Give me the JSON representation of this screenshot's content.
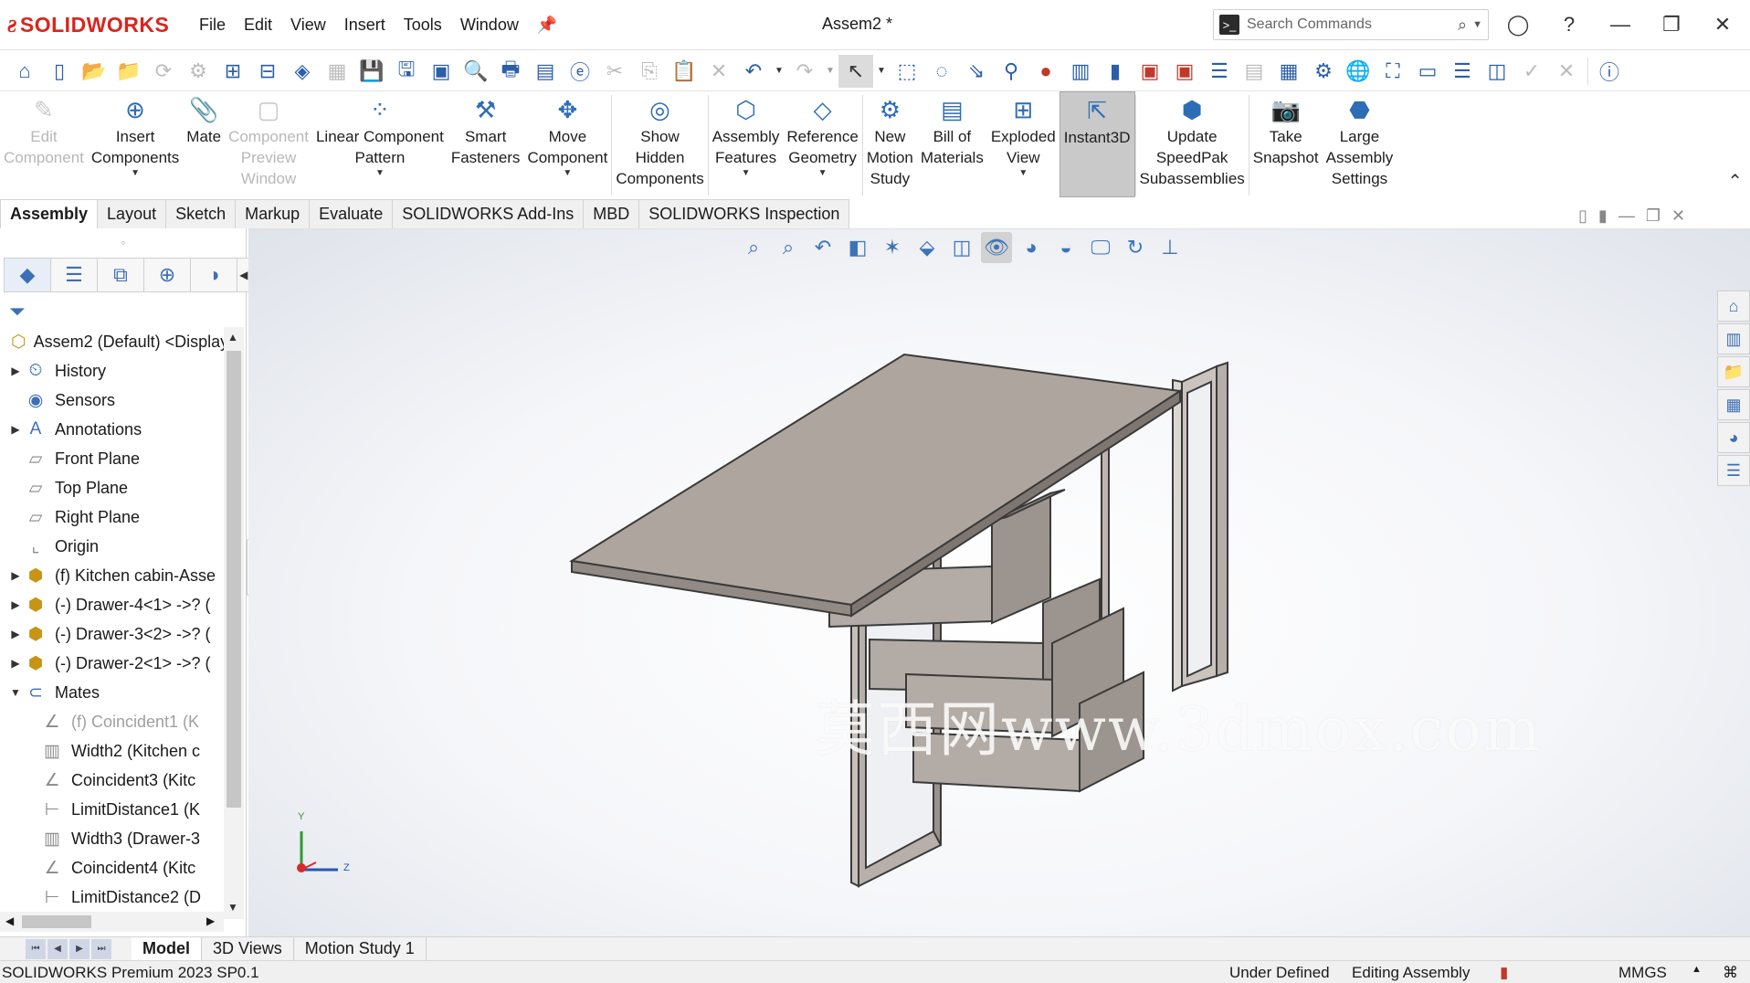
{
  "app": {
    "logo_prefix": "3S",
    "logo_name": "SOLIDWORKS",
    "doc_title": "Assem2 *"
  },
  "menu": [
    "File",
    "Edit",
    "View",
    "Insert",
    "Tools",
    "Window"
  ],
  "search": {
    "placeholder": "Search Commands"
  },
  "command_manager": [
    {
      "label": "Edit\nComponent",
      "icon": "edit-component-icon",
      "enabled": false
    },
    {
      "label": "Insert\nComponents",
      "icon": "insert-components-icon",
      "enabled": true,
      "dropdown": true
    },
    {
      "label": "Mate",
      "icon": "mate-icon",
      "enabled": true
    },
    {
      "label": "Component\nPreview\nWindow",
      "icon": "preview-window-icon",
      "enabled": false
    },
    {
      "label": "Linear Component\nPattern",
      "icon": "linear-pattern-icon",
      "enabled": true,
      "dropdown": true
    },
    {
      "label": "Smart\nFasteners",
      "icon": "smart-fasteners-icon",
      "enabled": true
    },
    {
      "label": "Move\nComponent",
      "icon": "move-component-icon",
      "enabled": true,
      "dropdown": true
    },
    {
      "label": "Show\nHidden\nComponents",
      "icon": "show-hidden-icon",
      "enabled": true
    },
    {
      "label": "Assembly\nFeatures",
      "icon": "assembly-features-icon",
      "enabled": true,
      "dropdown": true
    },
    {
      "label": "Reference\nGeometry",
      "icon": "reference-geometry-icon",
      "enabled": true,
      "dropdown": true
    },
    {
      "label": "New\nMotion\nStudy",
      "icon": "motion-study-icon",
      "enabled": true
    },
    {
      "label": "Bill of\nMaterials",
      "icon": "bill-of-materials-icon",
      "enabled": true
    },
    {
      "label": "Exploded\nView",
      "icon": "exploded-view-icon",
      "enabled": true,
      "dropdown": true
    },
    {
      "label": "Instant3D",
      "icon": "instant3d-icon",
      "enabled": true,
      "active": true
    },
    {
      "label": "Update\nSpeedPak\nSubassemblies",
      "icon": "speedpak-icon",
      "enabled": true
    },
    {
      "label": "Take\nSnapshot",
      "icon": "camera-icon",
      "enabled": true
    },
    {
      "label": "Large\nAssembly\nSettings",
      "icon": "large-assembly-icon",
      "enabled": true
    }
  ],
  "command_tabs": [
    "Assembly",
    "Layout",
    "Sketch",
    "Markup",
    "Evaluate",
    "SOLIDWORKS Add-Ins",
    "MBD",
    "SOLIDWORKS Inspection"
  ],
  "active_command_tab": "Assembly",
  "tree": [
    {
      "label": "Assem2 (Default) <Display",
      "icon": "assembly-icon",
      "level": 0,
      "expand": ""
    },
    {
      "label": "History",
      "icon": "history-icon",
      "level": 1,
      "expand": "▶"
    },
    {
      "label": "Sensors",
      "icon": "sensors-icon",
      "level": 1,
      "expand": ""
    },
    {
      "label": "Annotations",
      "icon": "annotations-icon",
      "level": 1,
      "expand": "▶"
    },
    {
      "label": "Front Plane",
      "icon": "plane-icon",
      "level": 1,
      "expand": ""
    },
    {
      "label": "Top Plane",
      "icon": "plane-icon",
      "level": 1,
      "expand": ""
    },
    {
      "label": "Right Plane",
      "icon": "plane-icon",
      "level": 1,
      "expand": ""
    },
    {
      "label": "Origin",
      "icon": "origin-icon",
      "level": 1,
      "expand": ""
    },
    {
      "label": "(f) Kitchen cabin-Asse",
      "icon": "subassembly-icon",
      "level": 1,
      "expand": "▶"
    },
    {
      "label": "(-) Drawer-4<1> ->? (",
      "icon": "subassembly-icon",
      "level": 1,
      "expand": "▶"
    },
    {
      "label": "(-) Drawer-3<2> ->? (",
      "icon": "subassembly-icon",
      "level": 1,
      "expand": "▶"
    },
    {
      "label": "(-) Drawer-2<1> ->? (",
      "icon": "subassembly-icon",
      "level": 1,
      "expand": "▶"
    },
    {
      "label": "Mates",
      "icon": "mates-icon",
      "level": 1,
      "expand": "▼"
    },
    {
      "label": "(f) Coincident1 (K",
      "icon": "coincident-icon",
      "level": 2,
      "expand": "",
      "dim": true
    },
    {
      "label": "Width2 (Kitchen c",
      "icon": "width-mate-icon",
      "level": 2,
      "expand": ""
    },
    {
      "label": "Coincident3 (Kitc",
      "icon": "coincident-icon",
      "level": 2,
      "expand": ""
    },
    {
      "label": "LimitDistance1 (K",
      "icon": "limit-distance-icon",
      "level": 2,
      "expand": ""
    },
    {
      "label": "Width3 (Drawer-3",
      "icon": "width-mate-icon",
      "level": 2,
      "expand": ""
    },
    {
      "label": "Coincident4 (Kitc",
      "icon": "coincident-icon",
      "level": 2,
      "expand": ""
    },
    {
      "label": "LimitDistance2 (D",
      "icon": "limit-distance-icon",
      "level": 2,
      "expand": ""
    }
  ],
  "triad": {
    "y": "Y",
    "z": "Z"
  },
  "watermark": "莫西网www.3dmox.com",
  "bottom_tabs": [
    "Model",
    "3D Views",
    "Motion Study 1"
  ],
  "active_bottom_tab": "Model",
  "status": {
    "product": "SOLIDWORKS Premium 2023 SP0.1",
    "definition": "Under Defined",
    "mode": "Editing Assembly",
    "units": "MMGS"
  },
  "colors": {
    "brand_red": "#d9251c",
    "icon_blue": "#3d6fb4",
    "model_face_top": "#ada49d",
    "model_face_side": "#8e8680",
    "model_edge": "#3a3a3a"
  }
}
